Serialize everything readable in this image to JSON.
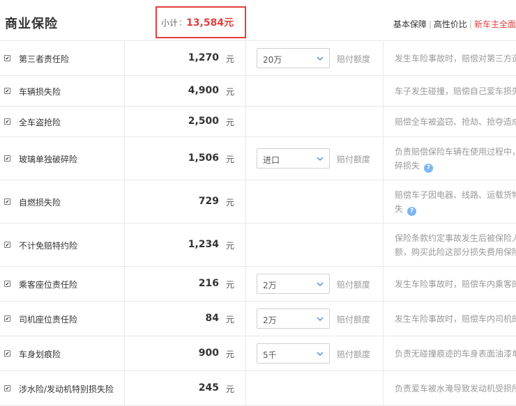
{
  "header": {
    "title": "商业保险",
    "subtotal_label": "小计",
    "subtotal_sep": ":",
    "subtotal_value": "13,584元",
    "filters": [
      "基本保障",
      "高性价比",
      "新车主全面"
    ]
  },
  "rows": [
    {
      "name": "第三者责任险",
      "price": "1,270",
      "unit": "元",
      "select": "20万",
      "coverage_label": "赔付额度",
      "desc": [
        "发生车险事故时，赔偿对第三方造"
      ],
      "help": false
    },
    {
      "name": "车辆损失险",
      "price": "4,900",
      "unit": "元",
      "select": null,
      "desc": [
        "车子发生碰撞，赔偿自己爱车损失"
      ],
      "help": false
    },
    {
      "name": "全车盗抢险",
      "price": "2,500",
      "unit": "元",
      "select": null,
      "desc": [
        "赔偿全车被盗窃、抢劫、抢夺造成"
      ],
      "help": false
    },
    {
      "name": "玻璃单独破碎险",
      "price": "1,506",
      "unit": "元",
      "select": "进口",
      "coverage_label": "赔付额度",
      "desc": [
        "负责赔偿保险车辆在使用过程中，",
        "碎损失"
      ],
      "help": true
    },
    {
      "name": "自燃损失险",
      "price": "729",
      "unit": "元",
      "select": null,
      "desc": [
        "赔偿车子因电器、线路、运载货物",
        "失"
      ],
      "help": true
    },
    {
      "name": "不计免赔特约险",
      "price": "1,234",
      "unit": "元",
      "select": null,
      "desc": [
        "保险条款约定事故发生后被保险人",
        "额，购买此险这部分损失费用保险"
      ],
      "help": false
    },
    {
      "name": "乘客座位责任险",
      "price": "216",
      "unit": "元",
      "select": "2万",
      "coverage_label": "赔付额度",
      "desc": [
        "发生车险事故时，赔偿车内乘客的"
      ],
      "help": false
    },
    {
      "name": "司机座位责任险",
      "price": "84",
      "unit": "元",
      "select": "2万",
      "coverage_label": "赔付额度",
      "desc": [
        "发生车险事故时，赔偿车内司机的"
      ],
      "help": false
    },
    {
      "name": "车身划痕险",
      "price": "900",
      "unit": "元",
      "select": "5千",
      "coverage_label": "赔付额度",
      "desc": [
        "负责无碰撞痕迹的车身表面油漆单"
      ],
      "help": false
    },
    {
      "name": "涉水险/发动机特别损失险",
      "price": "245",
      "unit": "元",
      "select": null,
      "desc": [
        "负责爱车被水淹导致发动机受损所"
      ],
      "help": false
    }
  ],
  "icons": {
    "checkbox": "checkmark-icon",
    "select_arrow": "chevron-down-icon",
    "help": "question-circle-icon"
  },
  "colors": {
    "accent": "#e13f3f",
    "help": "#7db6f2",
    "border": "#e8e8e8"
  }
}
